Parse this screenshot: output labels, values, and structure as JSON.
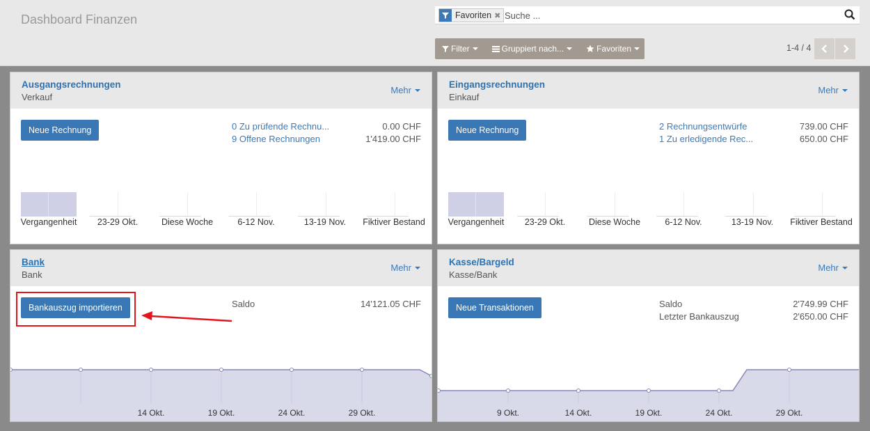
{
  "header": {
    "title": "Dashboard Finanzen",
    "search": {
      "facet": "Favoriten",
      "placeholder": "Suche ..."
    },
    "filters": {
      "filter": "Filter",
      "group_by": "Gruppiert nach...",
      "favorites": "Favoriten"
    },
    "pager": "1-4 / 4"
  },
  "cards": [
    {
      "title": "Ausgangsrechnungen",
      "subtitle": "Verkauf",
      "more": "Mehr",
      "button": "Neue Rechnung",
      "lines": [
        {
          "label": "0 Zu prüfende Rechnu...",
          "amount": "0.00 CHF"
        },
        {
          "label": "9 Offene Rechnungen",
          "amount": "1'419.00 CHF"
        }
      ],
      "chart_labels": [
        "Vergangenheit",
        "23-29 Okt.",
        "Diese Woche",
        "6-12 Nov.",
        "13-19 Nov.",
        "Fiktiver Bestand"
      ]
    },
    {
      "title": "Eingangsrechnungen",
      "subtitle": "Einkauf",
      "more": "Mehr",
      "button": "Neue Rechnung",
      "lines": [
        {
          "label": "2 Rechnungsentwürfe",
          "amount": "739.00 CHF"
        },
        {
          "label": "1 Zu erledigende Rec...",
          "amount": "650.00 CHF"
        }
      ],
      "chart_labels": [
        "Vergangenheit",
        "23-29 Okt.",
        "Diese Woche",
        "6-12 Nov.",
        "13-19 Nov.",
        "Fiktiver Bestand"
      ]
    },
    {
      "title": "Bank",
      "subtitle": "Bank",
      "more": "Mehr",
      "button": "Bankauszug importieren",
      "lines": [
        {
          "label": "Saldo",
          "amount": "14'121.05 CHF"
        }
      ],
      "chart_labels": [
        "14 Okt.",
        "19 Okt.",
        "24 Okt.",
        "29 Okt."
      ]
    },
    {
      "title": "Kasse/Bargeld",
      "subtitle": "Kasse/Bank",
      "more": "Mehr",
      "button": "Neue Transaktionen",
      "lines": [
        {
          "label": "Saldo",
          "amount": "2'749.99 CHF"
        },
        {
          "label": "Letzter Bankauszug",
          "amount": "2'650.00 CHF"
        }
      ],
      "chart_labels": [
        "9 Okt.",
        "14 Okt.",
        "19 Okt.",
        "24 Okt.",
        "29 Okt."
      ]
    }
  ],
  "colors": {
    "primary": "#3a77b5",
    "link": "#3b7ab8",
    "annotation": "#e3141b",
    "chart_fill": "#cfd0e5"
  }
}
